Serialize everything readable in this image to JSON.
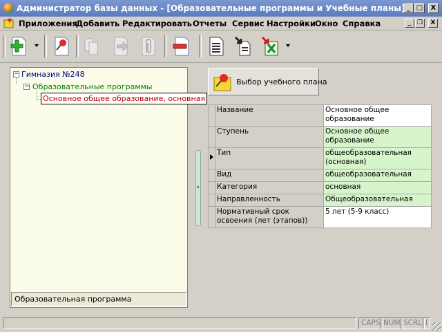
{
  "window": {
    "title": "Администратор базы данных - [Образовательные программы и Учебные планы]",
    "minimize_glyph": "_",
    "maximize_glyph": "□",
    "close_glyph": "X"
  },
  "menu": {
    "items": [
      "Приложения",
      "Добавить",
      "Редактировать",
      "Отчеты",
      "Сервис",
      "Настройки",
      "Окно",
      "Справка"
    ],
    "mdi_min": "_",
    "mdi_restore": "❐",
    "mdi_close": "X"
  },
  "toolbar": {
    "buttons": [
      {
        "name": "add-icon",
        "enabled": true,
        "dropdown": true
      },
      {
        "name": "edit-pin-icon",
        "enabled": true
      },
      {
        "name": "copy-icon",
        "enabled": false
      },
      {
        "name": "move-icon",
        "enabled": false
      },
      {
        "name": "attach-icon",
        "enabled": false
      },
      {
        "name": "delete-icon",
        "enabled": true
      },
      {
        "name": "report-icon",
        "enabled": true
      },
      {
        "name": "import-icon",
        "enabled": true
      },
      {
        "name": "excel-export-icon",
        "enabled": true,
        "dropdown": true
      }
    ]
  },
  "tree": {
    "root": {
      "label": "Гимназия №248",
      "expander": "−"
    },
    "child": {
      "label": "Образовательные программы",
      "expander": "−"
    },
    "selected": {
      "label": "Основное общее образование, основная"
    },
    "footer": "Образовательная программа"
  },
  "plan_button": {
    "label": "Выбор учебного плана"
  },
  "properties": [
    {
      "name": "Название",
      "value": "Основное общее образование",
      "highlight": false
    },
    {
      "name": "Ступень",
      "value": "Основное общее образование",
      "highlight": true
    },
    {
      "name": "Тип",
      "value": "общеобразовательная (основная)",
      "highlight": true
    },
    {
      "name": "Вид",
      "value": "общеобразовательная",
      "highlight": true
    },
    {
      "name": "Категория",
      "value": "основная",
      "highlight": true
    },
    {
      "name": "Направленность",
      "value": "Общеобразовательная",
      "highlight": true
    },
    {
      "name": "Нормативный срок освоения (лет (этапов))",
      "value": "5 лет (5-9 класс)",
      "highlight": false
    }
  ],
  "status": {
    "indicators": [
      "CAPS",
      "NUM",
      "SCRL",
      "I"
    ]
  },
  "colors": {
    "titlebar": "#6a8ac8",
    "tree_bg": "#fbfbe9",
    "green_cell": "#d7f5cc",
    "tree_root_text": "#000080",
    "tree_child_text": "#008000",
    "tree_selected_text": "#c00000"
  }
}
